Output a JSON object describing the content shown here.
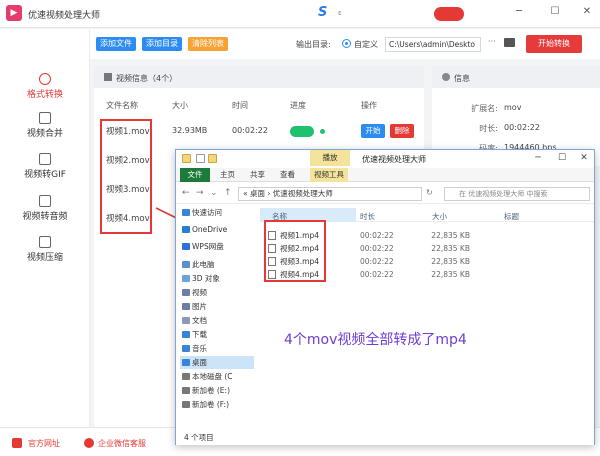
{
  "app": {
    "title": "优速视频处理大师",
    "brand_mark": "S",
    "brand_sub": "ε"
  },
  "window_controls": [
    "─",
    "☐",
    "✕"
  ],
  "toolbar": {
    "add_file": "添加文件",
    "add_dir": "添加目录",
    "clear_list": "清除列表",
    "output_label": "输出目录:",
    "radio_label": "自定义",
    "output_path": "C:\\Users\\admin\\Deskto",
    "browse": "···",
    "start": "开始转换"
  },
  "sidebar": [
    {
      "label": "格式转换",
      "icon": "format-convert-icon",
      "active": true
    },
    {
      "label": "视频合并",
      "icon": "video-merge-icon",
      "active": false
    },
    {
      "label": "视频转GIF",
      "icon": "gif-icon",
      "active": false
    },
    {
      "label": "视频转音频",
      "icon": "audio-icon",
      "active": false
    },
    {
      "label": "视频压缩",
      "icon": "compress-icon",
      "active": false
    }
  ],
  "video_panel": {
    "header": "视频信息（4个）",
    "columns": [
      "文件名称",
      "大小",
      "时间",
      "进度",
      "操作"
    ],
    "rows": [
      {
        "name": "视频1.mov",
        "size": "32.93MB",
        "time": "00:02:22"
      },
      {
        "name": "视频2.mov"
      },
      {
        "name": "视频3.mov"
      },
      {
        "name": "视频4.mov"
      }
    ],
    "open": "开始",
    "delete": "删除"
  },
  "info_panel": {
    "header": "信息",
    "fields": [
      {
        "key": "扩展名:",
        "value": "mov"
      },
      {
        "key": "时长:",
        "value": "00:02:22"
      },
      {
        "key": "码率:",
        "value": "1944460 bps"
      }
    ]
  },
  "bottom_bar": {
    "official_site": "官方网址",
    "wechat_support": "企业微信客服"
  },
  "explorer": {
    "manage_tab": "播放",
    "title": "优速视频处理大师",
    "tabs": [
      "文件",
      "主页",
      "共享",
      "查看",
      "视频工具"
    ],
    "address": "« 桌面 › 优速视频处理大师",
    "search_placeholder": "在 优速视频处理大师 中搜索",
    "nav": [
      {
        "label": "快速访问",
        "color": "#3b82d8"
      },
      {
        "label": "OneDrive",
        "color": "#2b7cd3"
      },
      {
        "label": "WPS网盘",
        "color": "#2f6fe0"
      },
      {
        "label": "此电脑",
        "color": "#5a8fd0"
      },
      {
        "label": "3D 对象",
        "color": "#6aa2e0"
      },
      {
        "label": "视频",
        "color": "#6a7ea8"
      },
      {
        "label": "图片",
        "color": "#6a7ea8"
      },
      {
        "label": "文档",
        "color": "#8a9ab8"
      },
      {
        "label": "下载",
        "color": "#3b82d8"
      },
      {
        "label": "音乐",
        "color": "#3b82d8"
      },
      {
        "label": "桌面",
        "color": "#3b82d8",
        "selected": true
      },
      {
        "label": "本地磁盘 (C",
        "color": "#777777"
      },
      {
        "label": "新加卷 (E:)",
        "color": "#777777"
      },
      {
        "label": "新加卷 (F:)",
        "color": "#777777"
      }
    ],
    "columns": [
      "名称",
      "时长",
      "大小",
      "标题"
    ],
    "files": [
      {
        "name": "视频1.mp4",
        "date": "00:02:22",
        "size": "22,835 KB"
      },
      {
        "name": "视频2.mp4",
        "date": "00:02:22",
        "size": "22,835 KB"
      },
      {
        "name": "视频3.mp4",
        "date": "00:02:22",
        "size": "22,835 KB"
      },
      {
        "name": "视频4.mp4",
        "date": "00:02:22",
        "size": "22,835 KB"
      }
    ],
    "status": "4 个项目",
    "caption": "4个mov视频全部转成了mp4"
  }
}
